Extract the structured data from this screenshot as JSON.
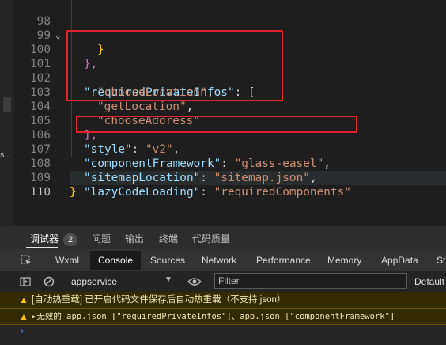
{
  "editor": {
    "lines": [
      {
        "num": "98"
      },
      {
        "num": "99"
      },
      {
        "num": "100"
      },
      {
        "num": "101"
      },
      {
        "num": "102"
      },
      {
        "num": "103"
      },
      {
        "num": "104"
      },
      {
        "num": "105"
      },
      {
        "num": "106"
      },
      {
        "num": "107"
      },
      {
        "num": "108"
      },
      {
        "num": "109"
      },
      {
        "num": "110"
      }
    ],
    "code": {
      "l98": "}",
      "l99": "},",
      "l100_key": "\"requiredPrivateInfos\"",
      "l100_rest": ": [",
      "l101": "\"chooseLocation\"",
      "l102": "\"getLocation\"",
      "l103": "\"chooseAddress\"",
      "l104": "],",
      "l105_key": "\"style\"",
      "l105_val": "\"v2\"",
      "l106_key": "\"componentFramework\"",
      "l106_val": "\"glass-easel\"",
      "l107_key": "\"sitemapLocation\"",
      "l107_val": "\"sitemap.json\"",
      "l108_key": "\"lazyCodeLoading\"",
      "l108_val": "\"requiredComponents\"",
      "l109": "}"
    }
  },
  "left_strip": {
    "dots": "s..."
  },
  "panel": {
    "tabs": [
      "调试器",
      "问题",
      "输出",
      "终端",
      "代码质量"
    ],
    "badge": "2",
    "devtools_tabs": [
      "Wxml",
      "Console",
      "Sources",
      "Network",
      "Performance",
      "Memory",
      "AppData",
      "St"
    ],
    "context": "appservice",
    "filter_placeholder": "Filter",
    "levels": "Default",
    "messages": [
      "[自动热重载] 已开启代码文件保存后自动热重载（不支持 json）",
      "▸无效的 app.json [\"requiredPrivateInfos\"]、app.json [\"componentFramework\"]"
    ],
    "prompt": "›"
  },
  "colors": {
    "annotation": "#e0232e",
    "key": "#9cdcfe",
    "string": "#ce9178",
    "warning_bg": "#332b00"
  }
}
